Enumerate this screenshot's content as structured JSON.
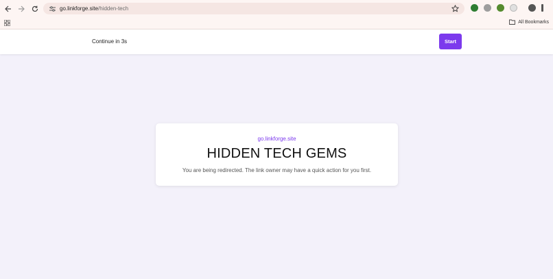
{
  "browser": {
    "url_host": "go.linkforge.site",
    "url_path": "/hidden-tech",
    "bookmarks_label": "All Bookmarks"
  },
  "header": {
    "countdown": "Continue in 3s",
    "start_label": "Start"
  },
  "card": {
    "domain": "go.linkforge.site",
    "title": "HIDDEN TECH GEMS",
    "message": "You are being redirected. The link owner may have a quick action for you first."
  },
  "colors": {
    "accent": "#7c3aed",
    "page_bg": "#f3f1fa"
  }
}
